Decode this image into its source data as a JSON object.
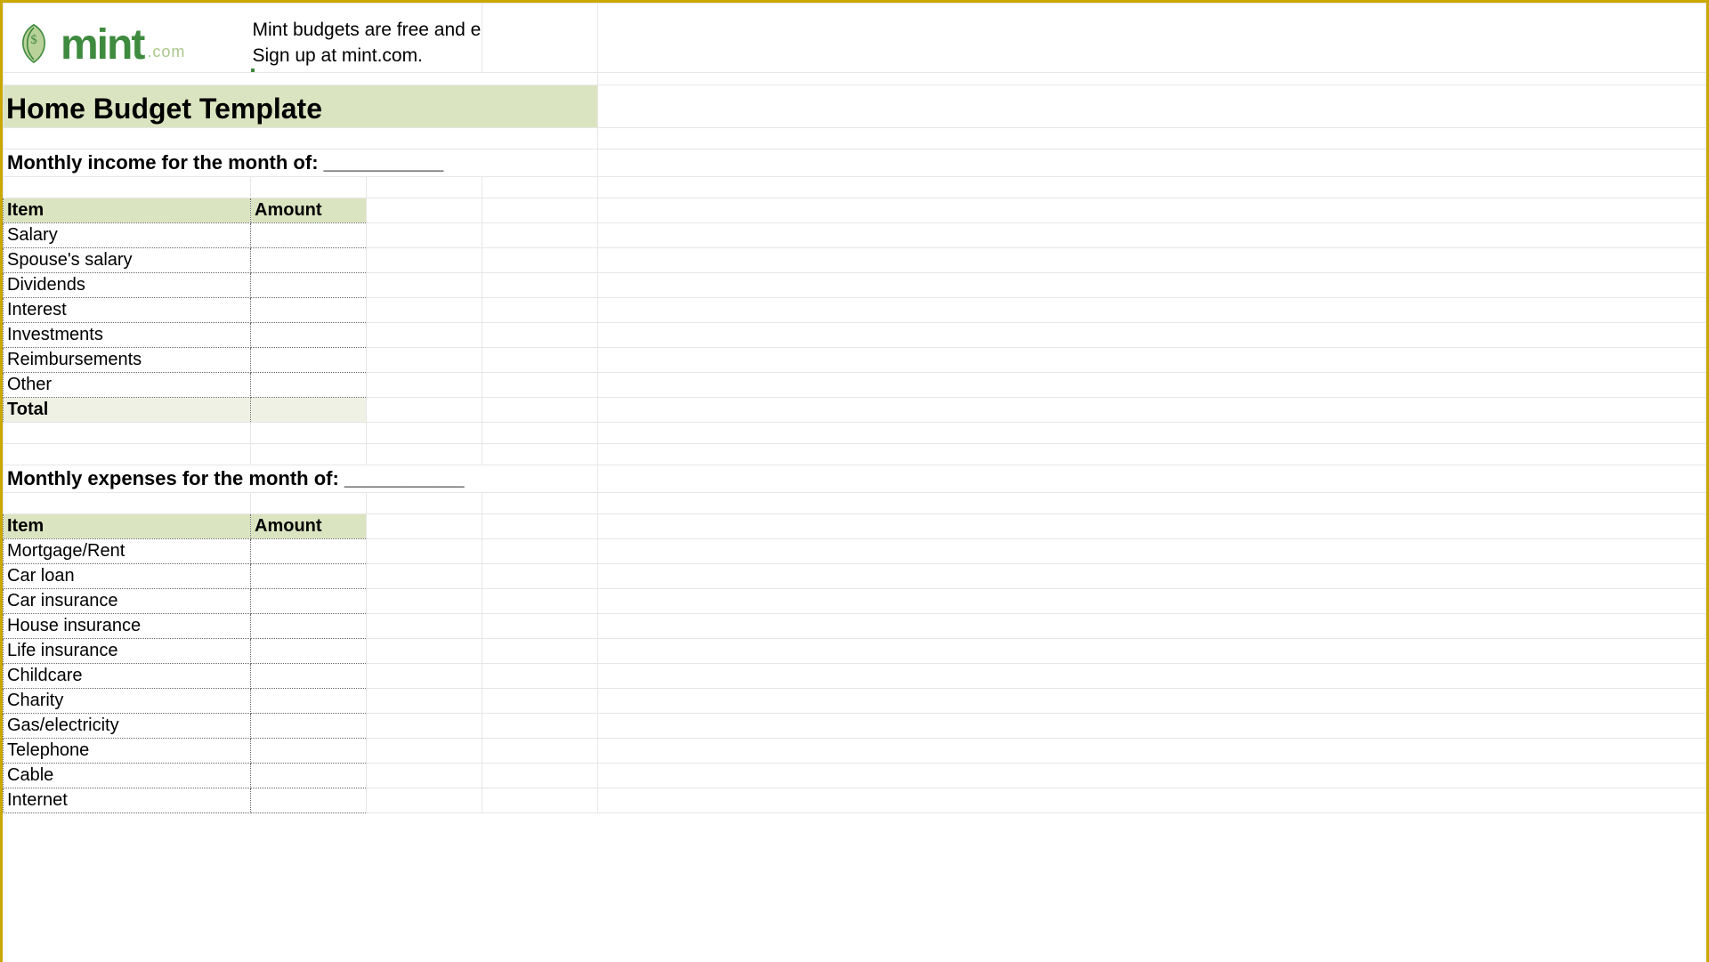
{
  "logo": {
    "brand": "mint",
    "ext": ".com"
  },
  "promo_line1": "Mint budgets are free and easy.",
  "promo_line2": "Sign up at mint.com.",
  "title": "Home Budget Template",
  "income_section_label": "Monthly income for the month of: ___________",
  "expense_section_label": "Monthly expenses for the month of: ___________",
  "columns": {
    "item": "Item",
    "amount": "Amount"
  },
  "income_items": [
    "Salary",
    "Spouse's salary",
    "Dividends",
    "Interest",
    "Investments",
    "Reimbursements",
    "Other"
  ],
  "income_total_label": "Total",
  "expense_items": [
    "Mortgage/Rent",
    "Car loan",
    "Car insurance",
    "House insurance",
    "Life insurance",
    "Childcare",
    "Charity",
    "Gas/electricity",
    "Telephone",
    "Cable",
    "Internet"
  ]
}
